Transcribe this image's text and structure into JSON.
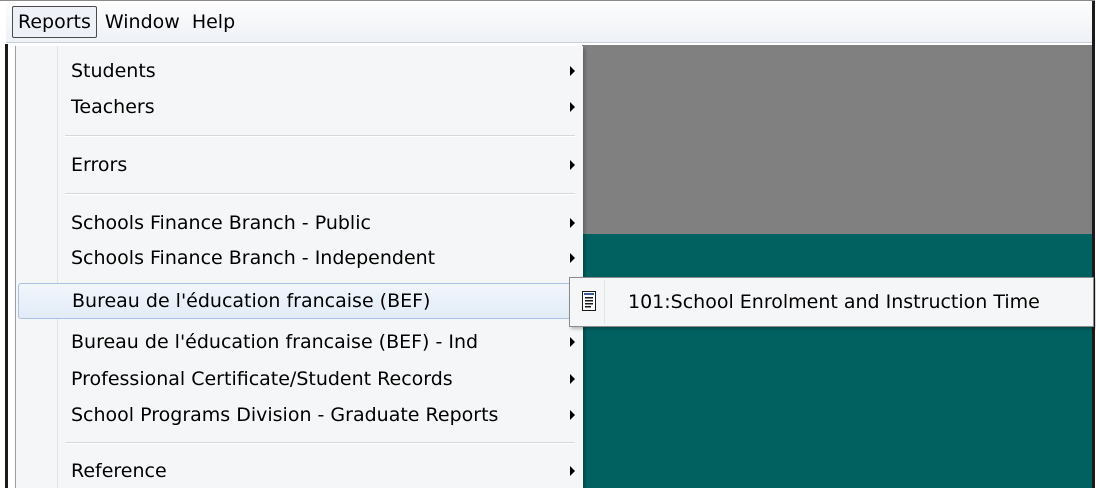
{
  "menubar": {
    "items": [
      {
        "label": "Reports"
      },
      {
        "label": "Window"
      },
      {
        "label": "Help"
      }
    ]
  },
  "reports_menu": {
    "items": [
      {
        "label": "Students"
      },
      {
        "label": "Teachers"
      },
      {
        "label": "Errors"
      },
      {
        "label": "Schools Finance Branch - Public"
      },
      {
        "label": "Schools Finance Branch - Independent"
      },
      {
        "label": "Bureau de l'éducation francaise (BEF)"
      },
      {
        "label": "Bureau de l'éducation francaise (BEF) - Ind"
      },
      {
        "label": "Professional Certificate/Student Records"
      },
      {
        "label": "School Programs Division - Graduate Reports"
      },
      {
        "label": "Reference"
      }
    ],
    "highlighted_index": 5
  },
  "submenu": {
    "items": [
      {
        "label": "101:School Enrolment and Instruction Time",
        "icon": "report-document-icon"
      }
    ]
  },
  "colors": {
    "background_gray": "#808080",
    "background_teal": "#006161",
    "highlight_border": "#a9c1e3"
  }
}
